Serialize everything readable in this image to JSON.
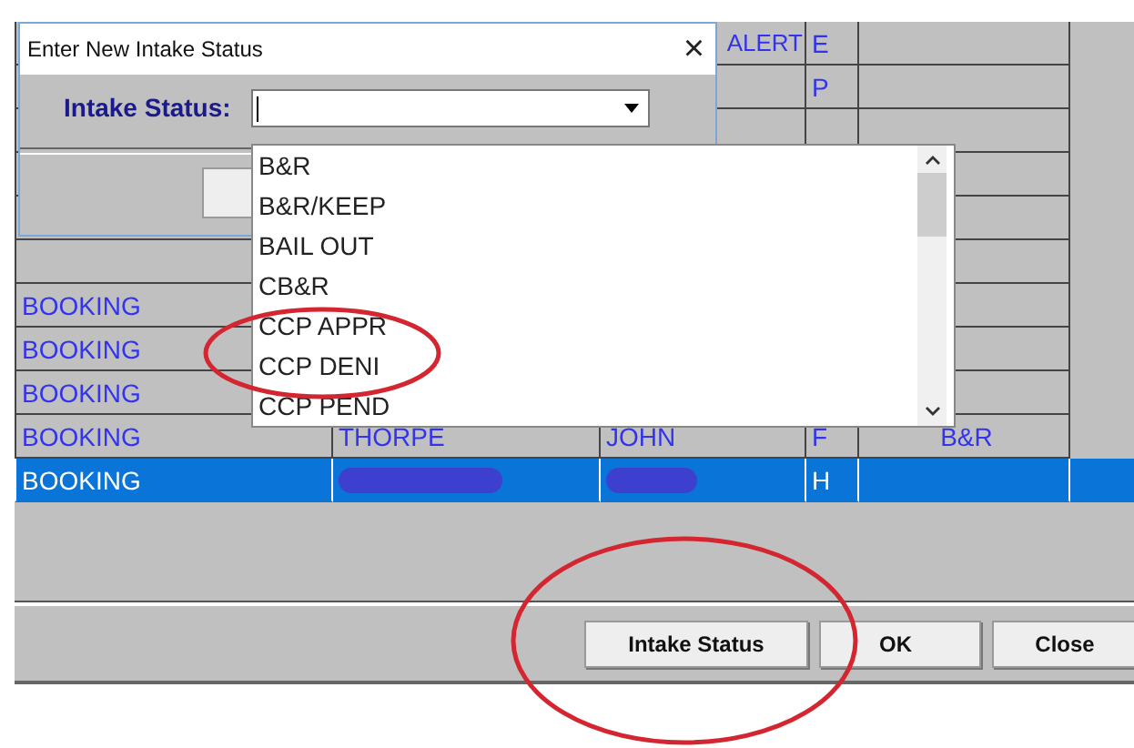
{
  "grid": {
    "rows": [
      {
        "selected": false,
        "column_3": "ALERT",
        "column_4": "E"
      },
      {
        "selected": false,
        "column_4": "P"
      },
      {
        "selected": false
      },
      {
        "selected": false
      },
      {
        "selected": false
      },
      {
        "selected": false
      },
      {
        "selected": false,
        "column_1": "BOOKING"
      },
      {
        "selected": false,
        "column_1": "BOOKING"
      },
      {
        "selected": false,
        "column_1": "BOOKING"
      },
      {
        "selected": false,
        "column_1": "BOOKING",
        "column_2": "THORPE",
        "column_3": "JOHN",
        "column_4": "F",
        "column_5": "B&R"
      },
      {
        "selected": true,
        "column_1": "BOOKING",
        "column_4": "H",
        "redacted": true
      }
    ]
  },
  "dialog": {
    "title": "Enter New Intake Status",
    "close": "×",
    "field_label": "Intake Status:",
    "dropdown": {
      "options": [
        {
          "label": "B&R",
          "selected": false
        },
        {
          "label": "B&R/KEEP",
          "selected": false
        },
        {
          "label": "BAIL OUT",
          "selected": false
        },
        {
          "label": "CB&R",
          "selected": false
        },
        {
          "label": "CCP APPR",
          "selected": false
        },
        {
          "label": "CCP DENI",
          "selected": false
        },
        {
          "label": "CCP PEND",
          "selected": false
        }
      ]
    }
  },
  "buttons": [
    "Intake Status",
    "OK",
    "Close"
  ]
}
